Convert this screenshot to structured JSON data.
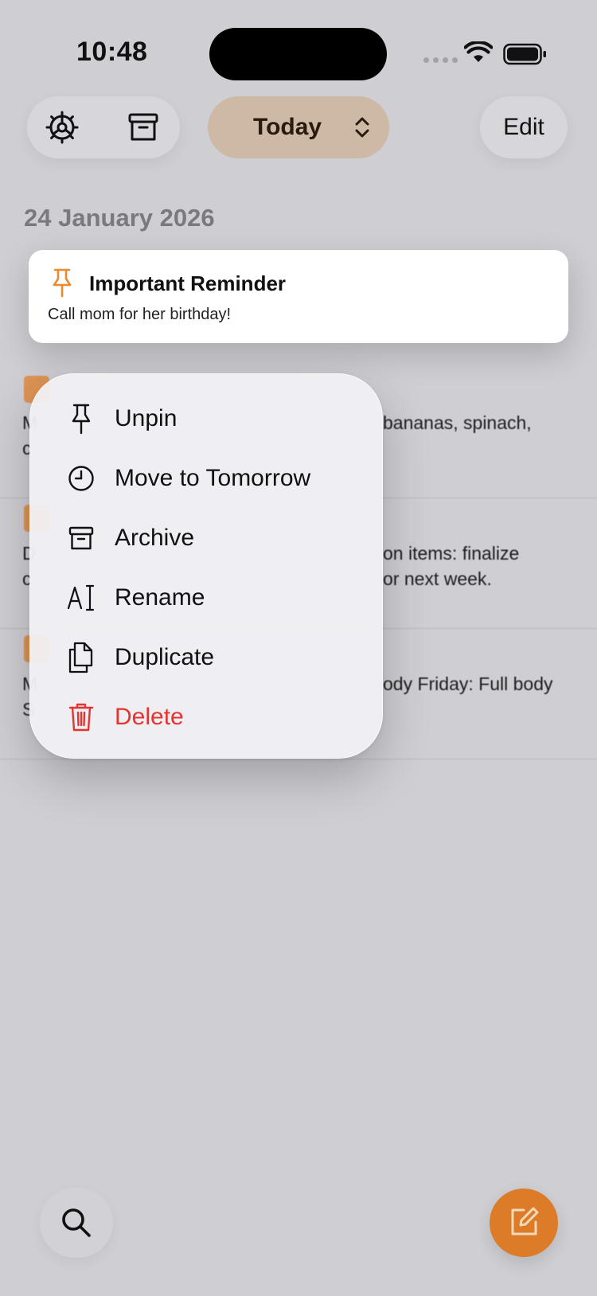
{
  "status_bar": {
    "time": "10:48"
  },
  "toolbar": {
    "settings_icon": "gear-icon",
    "archive_icon": "archive-box-icon",
    "filter_label": "Today",
    "edit_label": "Edit"
  },
  "date_heading": "24 January 2026",
  "pinned_note": {
    "title": "Important Reminder",
    "body": "Call mom for her birthday!",
    "icon": "pin-icon"
  },
  "background_notes": [
    {
      "line1_visible": "M",
      "line1_right": "bananas, spinach,",
      "line2_visible": "c"
    },
    {
      "line1_visible": "D",
      "line1_right": "on items: finalize",
      "line2_visible": "c",
      "line2_right": "or next week."
    },
    {
      "line1_visible": "M",
      "line1_right": "ody Friday: Full body",
      "line2_visible": "S"
    }
  ],
  "context_menu": {
    "items": [
      {
        "label": "Unpin",
        "icon": "pin-icon"
      },
      {
        "label": "Move to Tomorrow",
        "icon": "clock-icon"
      },
      {
        "label": "Archive",
        "icon": "archive-box-icon"
      },
      {
        "label": "Rename",
        "icon": "rename-text-cursor-icon"
      },
      {
        "label": "Duplicate",
        "icon": "duplicate-documents-icon"
      },
      {
        "label": "Delete",
        "icon": "trash-icon"
      }
    ]
  },
  "bottom_bar": {
    "search_icon": "search-icon",
    "compose_icon": "compose-icon"
  },
  "colors": {
    "accent": "#dc7c28",
    "danger": "#e5332f",
    "pill_today": "#cdb9a6",
    "background": "#cfced3"
  }
}
